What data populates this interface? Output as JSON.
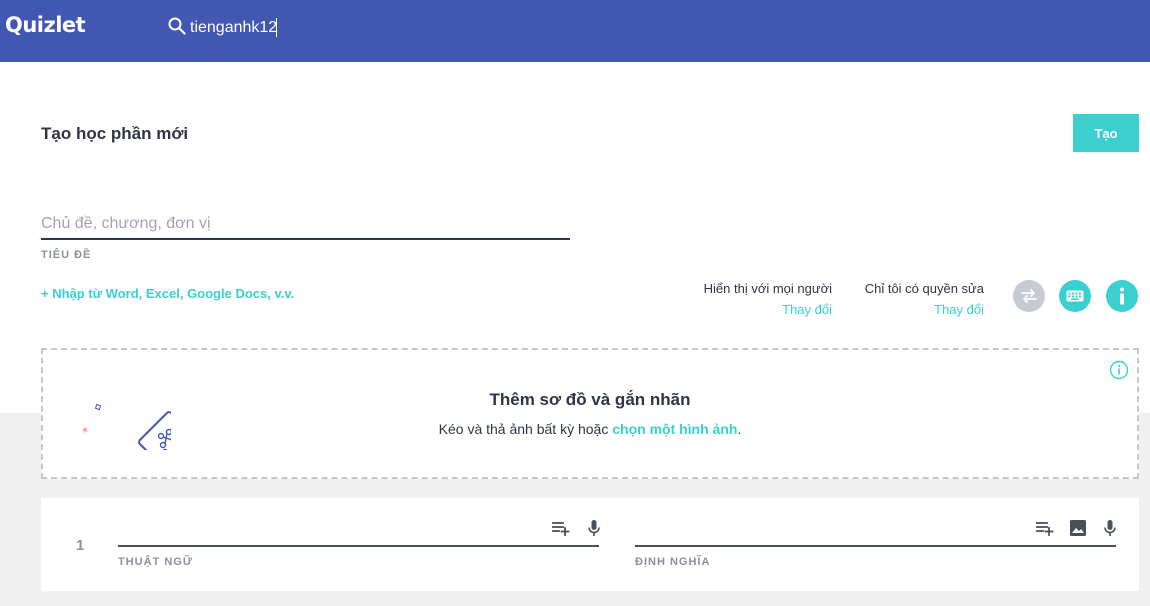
{
  "header": {
    "logo": "Quizlet",
    "search_value": "tienganhk12",
    "search_icon": "search-icon"
  },
  "page": {
    "title": "Tạo học phần mới",
    "create_button": "Tạo"
  },
  "set_title": {
    "placeholder": "Chủ đề, chương, đơn vị",
    "label": "TIÊU ĐỀ"
  },
  "import_link": "+ Nhập từ Word, Excel, Google Docs, v.v.",
  "permissions": {
    "visible": {
      "label": "Hiển thị với mọi người",
      "change": "Thay đổi"
    },
    "edit": {
      "label": "Chỉ tôi có quyền sửa",
      "change": "Thay đổi"
    }
  },
  "toolbar_icons": [
    "swap-icon",
    "keyboard-icon",
    "info-icon"
  ],
  "diagram": {
    "title": "Thêm sơ đồ và gắn nhãn",
    "desc_prefix": "Kéo và thả ảnh bất kỳ hoặc ",
    "desc_link": "chọn một hình ảnh",
    "desc_suffix": "."
  },
  "cards": [
    {
      "number": "1",
      "term_label": "THUẬT NGỮ",
      "definition_label": "ĐỊNH NGHĨA"
    }
  ],
  "colors": {
    "header_bg": "#4257b2",
    "accent": "#3ccfcf",
    "text": "#303545",
    "muted": "#8b909d"
  }
}
